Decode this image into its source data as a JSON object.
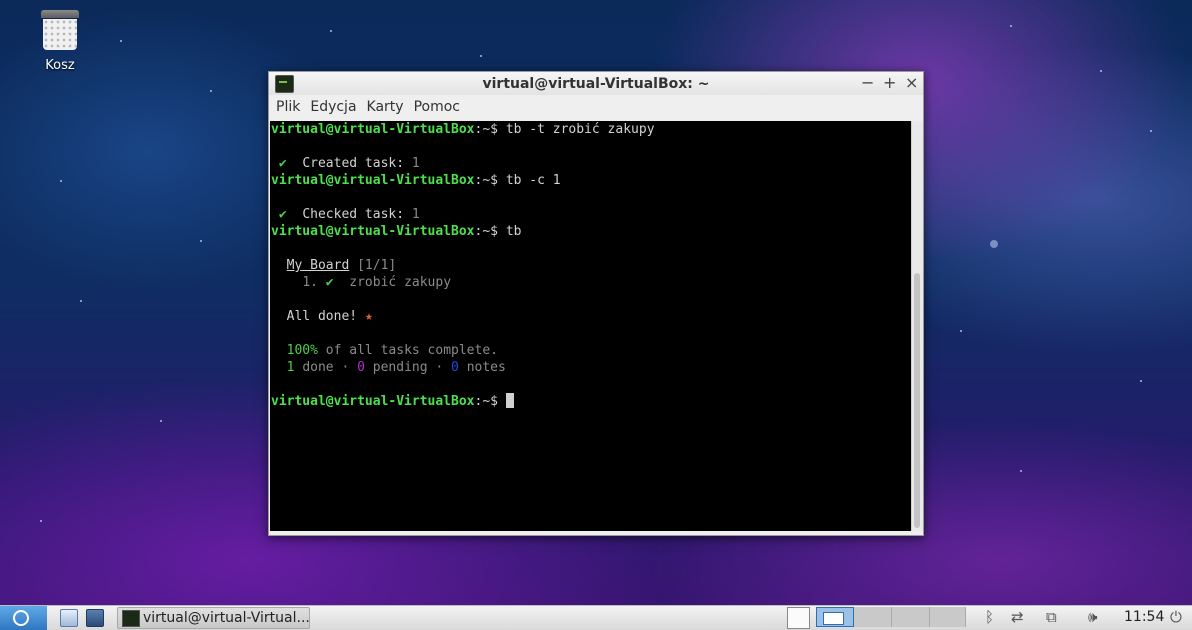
{
  "desktop": {
    "icons": [
      {
        "label": "Kosz",
        "icon": "trash-icon"
      }
    ]
  },
  "window": {
    "title": "virtual@virtual-VirtualBox: ~",
    "controls": {
      "minimize": "−",
      "maximize": "+",
      "close": "×"
    },
    "menu": [
      "Plik",
      "Edycja",
      "Karty",
      "Pomoc"
    ]
  },
  "terminal": {
    "prompt_user": "virtual@virtual-VirtualBox",
    "prompt_suffix": ":~$ ",
    "cmd1": "tb -t zrobić zakupy",
    "check_mark": "✔",
    "created_label": "Created task:",
    "created_id": "1",
    "cmd2": "tb -c 1",
    "checked_label": "Checked task:",
    "checked_id": "1",
    "cmd3": "tb",
    "board_name": "My Board",
    "board_count": "[1/1]",
    "task_number": "1.",
    "task_text": "zrobić zakupy",
    "all_done": "All done!",
    "star": "★",
    "percent": "100%",
    "percent_text": "of all tasks complete.",
    "done_count": "1",
    "done_label": "done",
    "pending_count": "0",
    "pending_label": "pending",
    "notes_count": "0",
    "notes_label": "notes",
    "separator": "·"
  },
  "taskbar": {
    "task_label": "virtual@virtual-Virtual...",
    "clock": "11:54",
    "tray_icons": [
      "bluetooth-icon",
      "network-icon",
      "display-icon",
      "volume-icon",
      "power-icon"
    ],
    "workspaces": 4,
    "active_workspace": 1
  }
}
